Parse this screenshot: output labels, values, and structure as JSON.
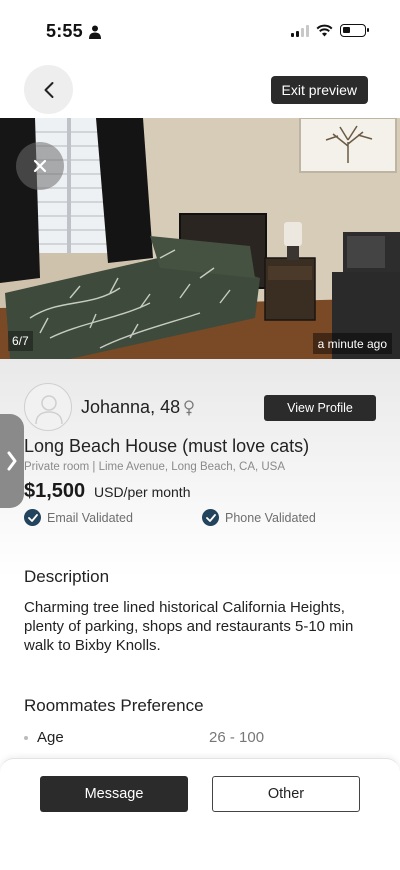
{
  "status_bar": {
    "time": "5:55"
  },
  "nav": {
    "exit_label": "Exit preview"
  },
  "photo": {
    "counter": "6/7",
    "posted": "a minute ago"
  },
  "profile": {
    "name": "Johanna, 48",
    "view_profile_label": "View Profile"
  },
  "listing": {
    "title": "Long Beach House (must love cats)",
    "subtitle": "Private room | Lime Avenue, Long Beach, CA, USA",
    "price": "$1,500",
    "price_unit": "USD/per month"
  },
  "verification": {
    "email": "Email Validated",
    "phone": "Phone Validated"
  },
  "description": {
    "heading": "Description",
    "text": "Charming tree lined historical California Heights, plenty of parking, shops and restaurants 5-10 min walk to Bixby Knolls."
  },
  "preferences": {
    "heading": "Roommates Preference",
    "items": [
      {
        "label": "Age",
        "value": "26 - 100"
      }
    ]
  },
  "actions": {
    "message_label": "Message",
    "other_label": "Other"
  },
  "colors": {
    "dark_button": "#2b2b2b",
    "check_badge": "#24435c",
    "muted_text": "#8a8a8a"
  },
  "icons": {
    "back": "chevron-left-icon",
    "close": "close-icon",
    "side_tab": "chevron-right-icon",
    "gender": "female-symbol-icon",
    "check": "check-circle-icon"
  }
}
